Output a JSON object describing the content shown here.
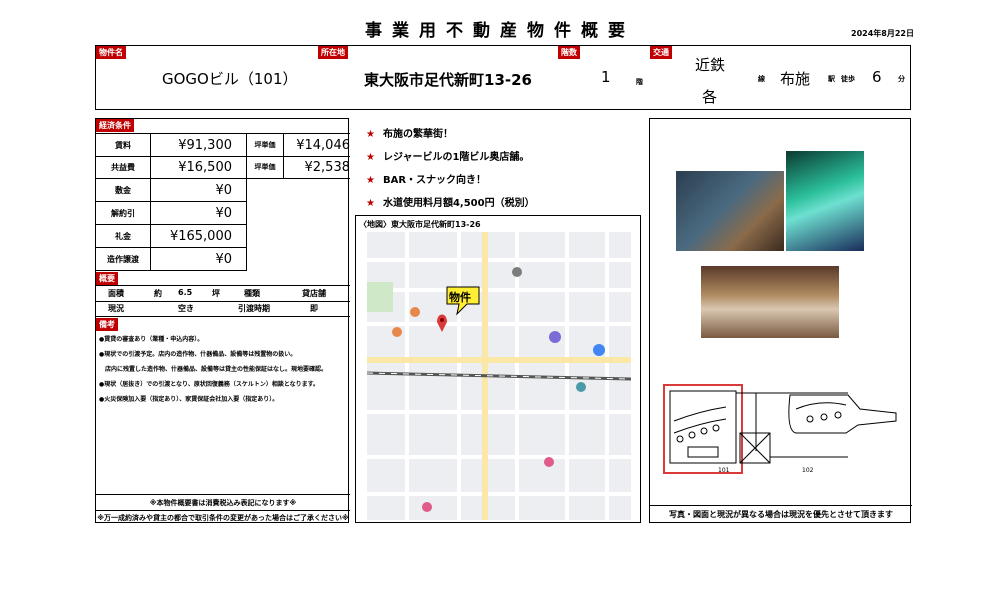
{
  "header": {
    "title": "事業用不動産物件概要",
    "date": "2024年8月22日"
  },
  "top": {
    "name_tag": "物件名",
    "name": "GOGOビル（101）",
    "loc_tag": "所在地",
    "location": "東大阪市足代新町13-26",
    "floor_tag": "階数",
    "floor": "1",
    "floor_unit": "階",
    "traffic_tag": "交通",
    "line": "近鉄",
    "line2": "各",
    "line_unit": "線",
    "station": "布施",
    "station_unit": "駅",
    "walk_label": "徒歩",
    "walk": "6",
    "walk_unit": "分"
  },
  "economy": {
    "tag": "経済条件",
    "rent_label": "賃料",
    "rent": "¥91,300",
    "tsubo_label": "坪単価",
    "rent_tsubo": "¥14,046",
    "common_label": "共益費",
    "common": "¥16,500",
    "common_tsubo": "¥2,538",
    "deposit_label": "敷金",
    "deposit": "¥0",
    "cancel_label": "解約引",
    "cancel": "¥0",
    "key_label": "礼金",
    "key_money": "¥165,000",
    "transfer_label": "造作譲渡",
    "transfer": "¥0"
  },
  "summary": {
    "tag": "概要",
    "area_label": "面積",
    "area_prefix": "約",
    "area": "6.5",
    "area_unit": "坪",
    "type_label": "種類",
    "type": "貸店舗",
    "status_label": "現況",
    "status": "空き",
    "handover_label": "引渡時期",
    "handover": "即"
  },
  "remarks": {
    "tag": "備考",
    "lines": [
      "●賃貸の審査あり（業種・申込内容）。",
      "●現状での引渡予定。店内の造作物、什器備品、設備等は残置物の扱い。",
      "　店内に残置した造作物、什器備品、設備等は貸主の性能保証はなし。現地要確認。",
      "●現状（居抜き）での引渡となり、原状回復義務（スケルトン）相談となります。",
      "●火災保険加入要（指定あり）、家賃保証会社加入要（指定あり）。"
    ],
    "footer1": "※本物件概要書は消費税込み表記になります※",
    "footer2": "※万一成約済みや貸主の都合で取引条件の変更があった場合はご了承ください※"
  },
  "points": [
    "布施の繁華街！",
    "レジャービルの1階ビル奥店舗。",
    "BAR・スナック向き！",
    "水道使用料月額4,500円（税別）"
  ],
  "point_star": "★",
  "map": {
    "label": "〈地図〉東大阪市足代新町13-26",
    "pin_label": "物件"
  },
  "floorplan": {
    "unit_a": "101",
    "unit_b": "102"
  },
  "photos_caption": "写真・図面と現況が異なる場合は現況を優先とさせて頂きます",
  "colors": {
    "tag_red": "#c00000",
    "highlight": "#d93a3a",
    "pin_yellow": "#ffee33"
  }
}
